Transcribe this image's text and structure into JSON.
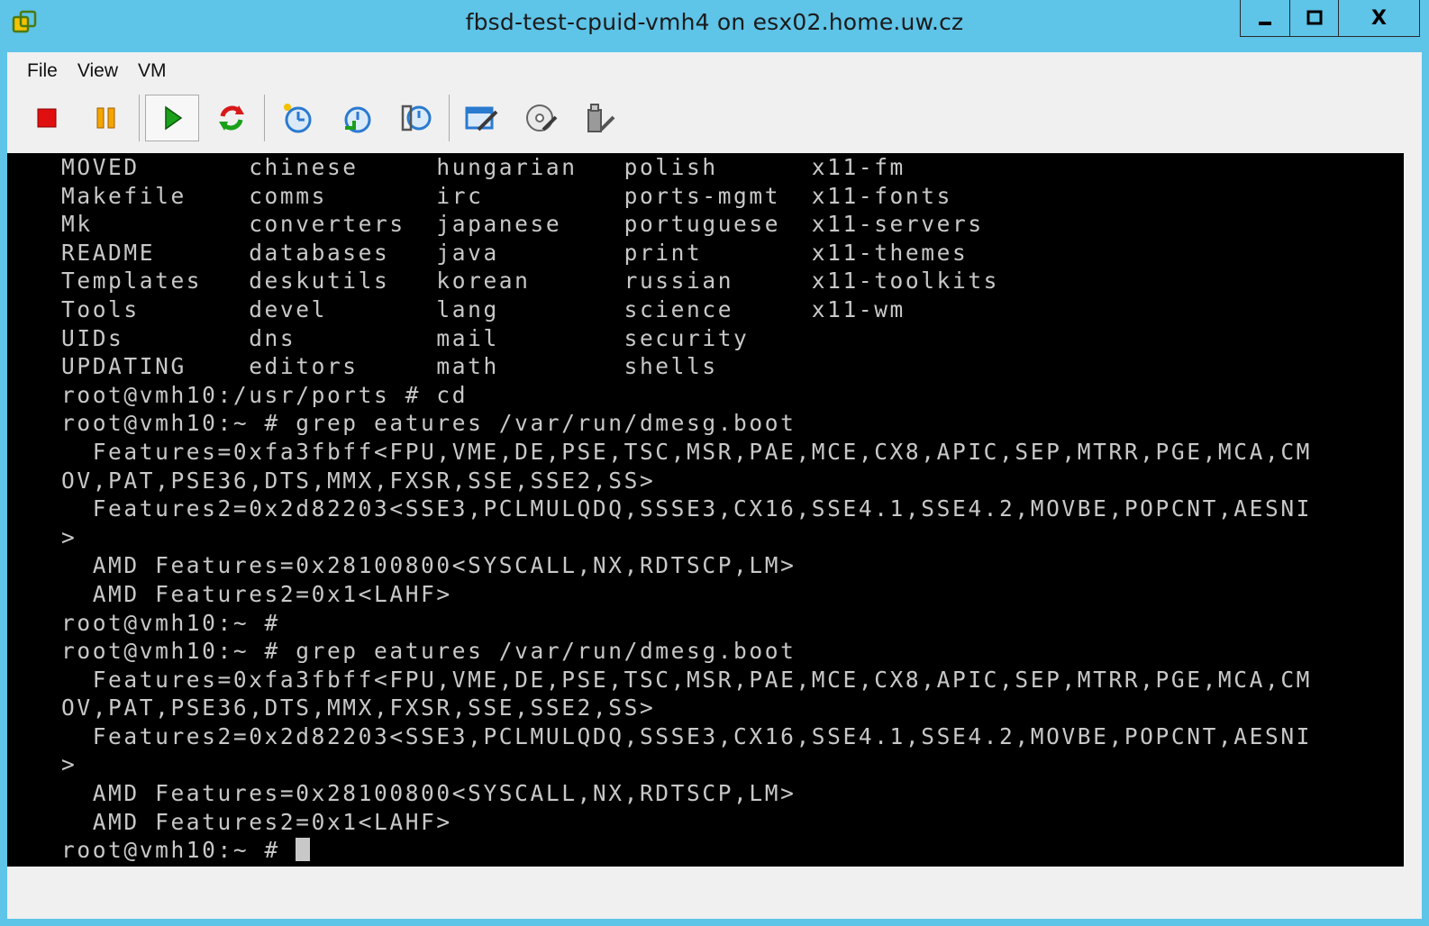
{
  "window": {
    "title": "fbsd-test-cpuid-vmh4 on esx02.home.uw.cz",
    "controls": {
      "minimize": "▁",
      "maximize": "▢",
      "close": "X"
    }
  },
  "menu": {
    "file": "File",
    "view": "View",
    "vm": "VM"
  },
  "toolbar": {
    "icons": [
      "stop-icon",
      "pause-icon",
      "play-icon",
      "reset-icon",
      "snapshot-icon",
      "revert-snapshot-icon",
      "snapshot-manager-icon",
      "edit-settings-icon",
      "cd-dvd-icon",
      "usb-icon"
    ],
    "colors": {
      "stop": "#e01010",
      "pause": "#f5a500",
      "play": "#1aa01a",
      "reset": "#d81818",
      "blue": "#2a7ad0"
    }
  },
  "console": {
    "lines": [
      "MOVED       chinese     hungarian   polish      x11-fm",
      "Makefile    comms       irc         ports-mgmt  x11-fonts",
      "Mk          converters  japanese    portuguese  x11-servers",
      "README      databases   java        print       x11-themes",
      "Templates   deskutils   korean      russian     x11-toolkits",
      "Tools       devel       lang        science     x11-wm",
      "UIDs        dns         mail        security",
      "UPDATING    editors     math        shells",
      "root@vmh10:/usr/ports # cd",
      "root@vmh10:~ # grep eatures /var/run/dmesg.boot",
      "  Features=0xfa3fbff<FPU,VME,DE,PSE,TSC,MSR,PAE,MCE,CX8,APIC,SEP,MTRR,PGE,MCA,CM",
      "OV,PAT,PSE36,DTS,MMX,FXSR,SSE,SSE2,SS>",
      "  Features2=0x2d82203<SSE3,PCLMULQDQ,SSSE3,CX16,SSE4.1,SSE4.2,MOVBE,POPCNT,AESNI",
      ">",
      "  AMD Features=0x28100800<SYSCALL,NX,RDTSCP,LM>",
      "  AMD Features2=0x1<LAHF>",
      "root@vmh10:~ #",
      "root@vmh10:~ # grep eatures /var/run/dmesg.boot",
      "  Features=0xfa3fbff<FPU,VME,DE,PSE,TSC,MSR,PAE,MCE,CX8,APIC,SEP,MTRR,PGE,MCA,CM",
      "OV,PAT,PSE36,DTS,MMX,FXSR,SSE,SSE2,SS>",
      "  Features2=0x2d82203<SSE3,PCLMULQDQ,SSSE3,CX16,SSE4.1,SSE4.2,MOVBE,POPCNT,AESNI",
      ">",
      "  AMD Features=0x28100800<SYSCALL,NX,RDTSCP,LM>",
      "  AMD Features2=0x1<LAHF>"
    ],
    "prompt": "root@vmh10:~ # "
  }
}
